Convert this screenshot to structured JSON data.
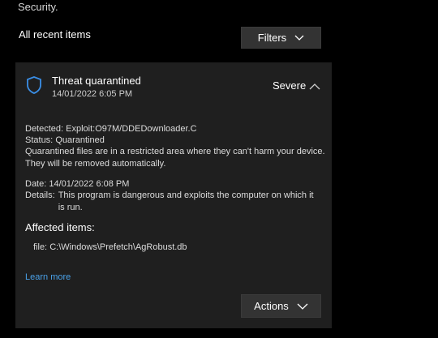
{
  "header": {
    "partial_text": "Security.",
    "all_recent_label": "All recent items",
    "filters_label": "Filters"
  },
  "card": {
    "title": "Threat quarantined",
    "date": "14/01/2022 6:05 PM",
    "severity": "Severe",
    "detected_label": "Detected:",
    "detected_value": "Exploit:O97M/DDEDownloader.C",
    "status_label": "Status:",
    "status_value": "Quarantined",
    "quarantine_note": "Quarantined files are in a restricted area where they can't harm your device. They will be removed automatically.",
    "date_label": "Date:",
    "date_value": "14/01/2022 6:08 PM",
    "details_label": "Details:",
    "details_value": "This program is dangerous and exploits the computer on which it is run.",
    "affected_title": "Affected items:",
    "file_label": "file:",
    "file_path": "C:\\Windows\\Prefetch\\AgRobust.db",
    "learn_more": "Learn more",
    "actions_label": "Actions"
  },
  "colors": {
    "background": "#000000",
    "card": "#1f1f1f",
    "button": "#333333",
    "link": "#4aa1e8",
    "shield": "#3a8ee6"
  },
  "icons": {
    "shield": "shield-icon",
    "chevron_up": "chevron-up-icon",
    "chevron_down": "chevron-down-icon"
  }
}
